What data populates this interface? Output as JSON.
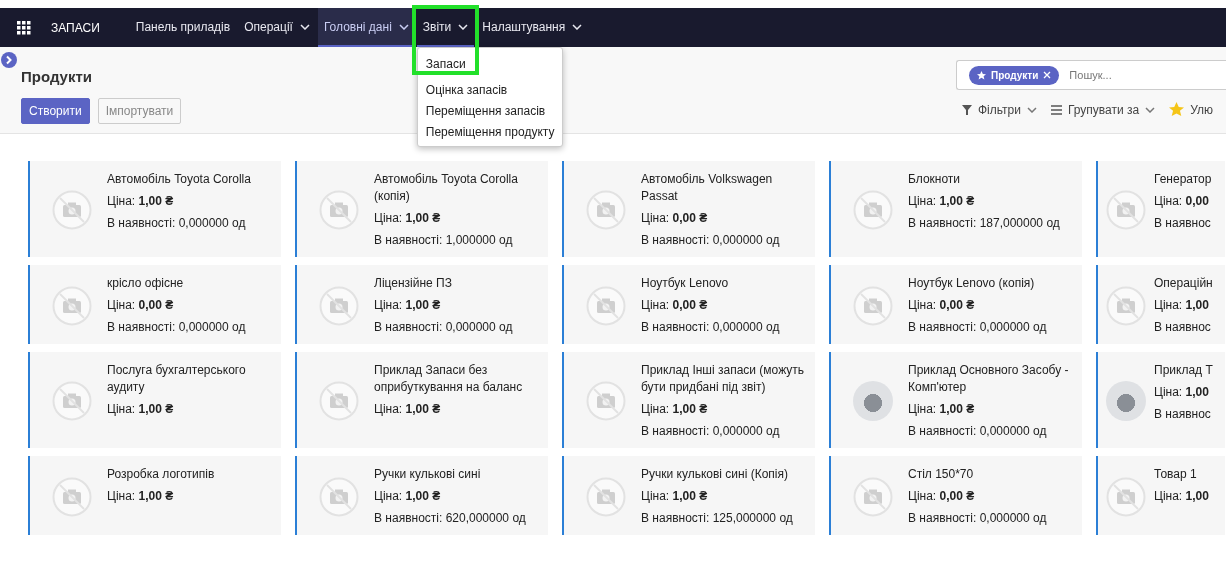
{
  "navbar": {
    "app_title": "ЗАПАСИ",
    "menu": [
      {
        "label": "Панель приладів",
        "dropdown": false,
        "selected": false,
        "open": false
      },
      {
        "label": "Операції",
        "dropdown": true,
        "selected": false,
        "open": false
      },
      {
        "label": "Головні дані",
        "dropdown": true,
        "selected": true,
        "open": false
      },
      {
        "label": "Звіти",
        "dropdown": true,
        "selected": false,
        "open": true,
        "highlighted": true,
        "items": [
          {
            "label": "Запаси"
          },
          {
            "label": "Оцінка запасів"
          },
          {
            "label": "Переміщення запасів"
          },
          {
            "label": "Переміщення продукту"
          }
        ]
      },
      {
        "label": "Налаштування",
        "dropdown": true,
        "selected": false,
        "open": false
      }
    ]
  },
  "control_panel": {
    "title": "Продукти",
    "buttons": [
      {
        "label": "Створити",
        "kind": "primary"
      },
      {
        "label": "Імпортувати",
        "kind": "secondary"
      }
    ],
    "search": {
      "facet": "Продукти",
      "placeholder": "Пошук..."
    },
    "toolbar": [
      {
        "label": "Фільтри",
        "kind": "filter"
      },
      {
        "label": "Групувати за",
        "kind": "group"
      },
      {
        "label": "Улю",
        "kind": "favorite"
      }
    ]
  },
  "products": [
    {
      "kind": "placeholder",
      "name": "Автомобіль Toyota Corolla",
      "price": "Ціна: **1,00 ₴**",
      "stock": "В наявності: 0,000000 од"
    },
    {
      "kind": "placeholder",
      "name": "Автомобіль Toyota Corolla (копія)",
      "price": "Ціна: **1,00 ₴**",
      "stock": "В наявності: 1,000000 од"
    },
    {
      "kind": "placeholder",
      "name": "Автомобіль Volkswagen Passat",
      "price": "Ціна: **0,00 ₴**",
      "stock": "В наявності: 0,000000 од"
    },
    {
      "kind": "placeholder",
      "name": "Блокноти",
      "price": "Ціна: **1,00 ₴**",
      "stock": "В наявності: 187,000000 од"
    },
    {
      "kind": "placeholder",
      "name": "Генератор",
      "price": "Ціна: **0,00**",
      "stock": "В наявнос"
    },
    {
      "kind": "placeholder",
      "name": "крісло офісне",
      "price": "Ціна: **0,00 ₴**",
      "stock": "В наявності: 0,000000 од"
    },
    {
      "kind": "placeholder",
      "name": "Ліцензійне ПЗ",
      "price": "Ціна: **1,00 ₴**",
      "stock": "В наявності: 0,000000 од"
    },
    {
      "kind": "placeholder",
      "name": "Ноутбук Lenovo",
      "price": "Ціна: **0,00 ₴**",
      "stock": "В наявності: 0,000000 од"
    },
    {
      "kind": "placeholder",
      "name": "Ноутбук Lenovo (копія)",
      "price": "Ціна: **0,00 ₴**",
      "stock": "В наявності: 0,000000 од"
    },
    {
      "kind": "placeholder",
      "name": "Операційн",
      "price": "Ціна: **1,00**",
      "stock": "В наявнос"
    },
    {
      "kind": "placeholder",
      "name": "Послуга бухгалтерського аудиту",
      "price": "Ціна: **1,00 ₴**"
    },
    {
      "kind": "placeholder",
      "name": "Приклад Запаси без оприбуткування на баланс",
      "price": "Ціна: **1,00 ₴**"
    },
    {
      "kind": "placeholder",
      "name": "Приклад Інші запаси (можуть бути придбані під звіт)",
      "price": "Ціна: **1,00 ₴**",
      "stock": "В наявності: 0,000000 од"
    },
    {
      "kind": "photo",
      "name": "Приклад Основного Засобу - Комп'ютер",
      "price": "Ціна: **1,00 ₴**",
      "stock": "В наявності: 0,000000 од"
    },
    {
      "kind": "photo",
      "name": "Приклад Т",
      "price": "Ціна: **1,00**",
      "stock": "В наявнос"
    },
    {
      "kind": "placeholder",
      "name": "Розробка логотипів",
      "price": "Ціна: **1,00 ₴**"
    },
    {
      "kind": "placeholder",
      "name": "Ручки кулькові сині",
      "price": "Ціна: **1,00 ₴**",
      "stock": "В наявності: 620,000000 од"
    },
    {
      "kind": "placeholder",
      "name": "Ручки кулькові сині (Копія)",
      "price": "Ціна: **1,00 ₴**",
      "stock": "В наявності: 125,000000 од"
    },
    {
      "kind": "placeholder",
      "name": "Стіл 150*70",
      "price": "Ціна: **0,00 ₴**",
      "stock": "В наявності: 0,000000 од"
    },
    {
      "kind": "placeholder",
      "name": "Товар 1",
      "price": "Ціна: **1,00**"
    }
  ]
}
